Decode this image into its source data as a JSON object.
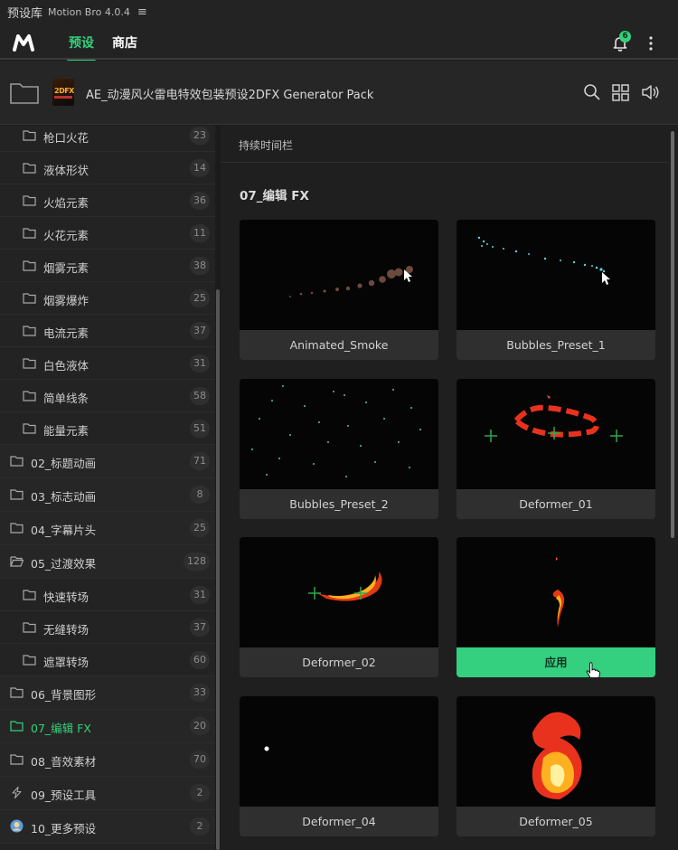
{
  "titlebar": {
    "title": "预设库",
    "app": "Motion Bro 4.0.4",
    "menu_glyph": "≡"
  },
  "nav": {
    "tab_presets": "预设",
    "tab_store": "商店",
    "notifications": "6"
  },
  "pack": {
    "title": "AE_动漫风火雷电特效包装预设2DFX Generator Pack",
    "thumb_text": "2DFX"
  },
  "sidebar": {
    "items": [
      {
        "label": "枪口火花",
        "count": "23"
      },
      {
        "label": "液体形状",
        "count": "14"
      },
      {
        "label": "火焰元素",
        "count": "36"
      },
      {
        "label": "火花元素",
        "count": "11"
      },
      {
        "label": "烟雾元素",
        "count": "38"
      },
      {
        "label": "烟雾爆炸",
        "count": "25"
      },
      {
        "label": "电流元素",
        "count": "37"
      },
      {
        "label": "白色液体",
        "count": "31"
      },
      {
        "label": "简单线条",
        "count": "58"
      },
      {
        "label": "能量元素",
        "count": "51"
      },
      {
        "label": "02_标题动画",
        "count": "71"
      },
      {
        "label": "03_标志动画",
        "count": "8"
      },
      {
        "label": "04_字幕片头",
        "count": "25"
      },
      {
        "label": "05_过渡效果",
        "count": "128"
      },
      {
        "label": "快速转场",
        "count": "31"
      },
      {
        "label": "无缝转场",
        "count": "37"
      },
      {
        "label": "遮罩转场",
        "count": "60"
      },
      {
        "label": "06_背景图形",
        "count": "33"
      },
      {
        "label": "07_编辑 FX",
        "count": "20"
      },
      {
        "label": "08_音效素材",
        "count": "70"
      },
      {
        "label": "09_预设工具",
        "count": "2"
      },
      {
        "label": "10_更多预设",
        "count": "2"
      }
    ]
  },
  "content": {
    "breadcrumb": "持续时间栏",
    "section_title": "07_编辑 FX",
    "cards": [
      {
        "label": "Animated_Smoke"
      },
      {
        "label": "Bubbles_Preset_1"
      },
      {
        "label": "Bubbles_Preset_2"
      },
      {
        "label": "Deformer_01"
      },
      {
        "label": "Deformer_02"
      },
      {
        "label": "应用"
      },
      {
        "label": "Deformer_04"
      },
      {
        "label": "Deformer_05"
      }
    ]
  },
  "colors": {
    "accent": "#33d17a",
    "background": "#1e1e1e",
    "card": "#303030"
  },
  "icons": [
    "motion-bro-logo",
    "bell-icon",
    "more-vertical-icon",
    "folder-icon",
    "search-icon",
    "grid-view-icon",
    "volume-icon",
    "lightning-icon",
    "avatar-icon",
    "cursor-icon"
  ]
}
